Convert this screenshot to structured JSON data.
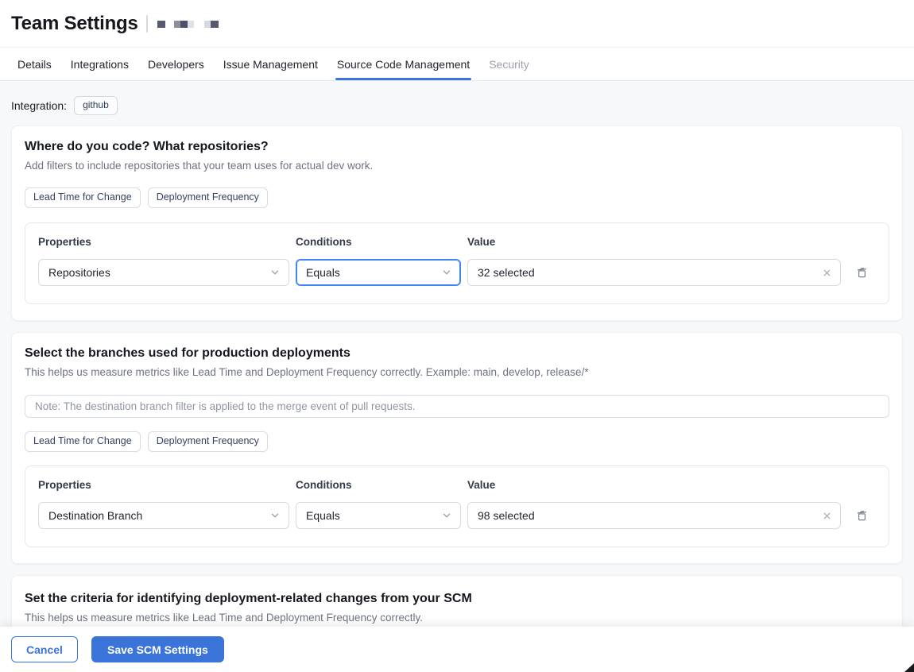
{
  "page": {
    "title": "Team Settings"
  },
  "tabs": {
    "items": [
      {
        "label": "Details"
      },
      {
        "label": "Integrations"
      },
      {
        "label": "Developers"
      },
      {
        "label": "Issue Management"
      },
      {
        "label": "Source Code Management"
      },
      {
        "label": "Security"
      }
    ],
    "active_tab": "Source Code Management",
    "disabled_tab": "Security"
  },
  "integration": {
    "label": "Integration:",
    "value": "github"
  },
  "filter_labels": {
    "properties": "Properties",
    "conditions": "Conditions",
    "value": "Value"
  },
  "cards": [
    {
      "title": "Where do you code? What repositories?",
      "subtitle": "Add filters to include repositories that your team uses for actual dev work.",
      "tags": [
        "Lead Time for Change",
        "Deployment Frequency"
      ],
      "filter": {
        "property": "Repositories",
        "condition": "Equals",
        "value": "32 selected"
      }
    },
    {
      "title": "Select the branches used for production deployments",
      "subtitle": "This helps us measure metrics like Lead Time and Deployment Frequency correctly. Example: main, develop, release/*",
      "note_placeholder": "Note: The destination branch filter is applied to the merge event of pull requests.",
      "tags": [
        "Lead Time for Change",
        "Deployment Frequency"
      ],
      "filter": {
        "property": "Destination Branch",
        "condition": "Equals",
        "value": "98 selected"
      }
    },
    {
      "title": "Set the criteria for identifying deployment-related changes from your SCM",
      "subtitle": "This helps us measure metrics like Lead Time and Deployment Frequency correctly."
    }
  ],
  "footer": {
    "cancel_label": "Cancel",
    "save_label": "Save SCM Settings"
  },
  "colors": {
    "accent_blue": "#3b74d9",
    "focus_blue": "#3f86f2",
    "page_bg": "#f7f8f9",
    "disabled_tab_text": "#9aa1ac"
  }
}
